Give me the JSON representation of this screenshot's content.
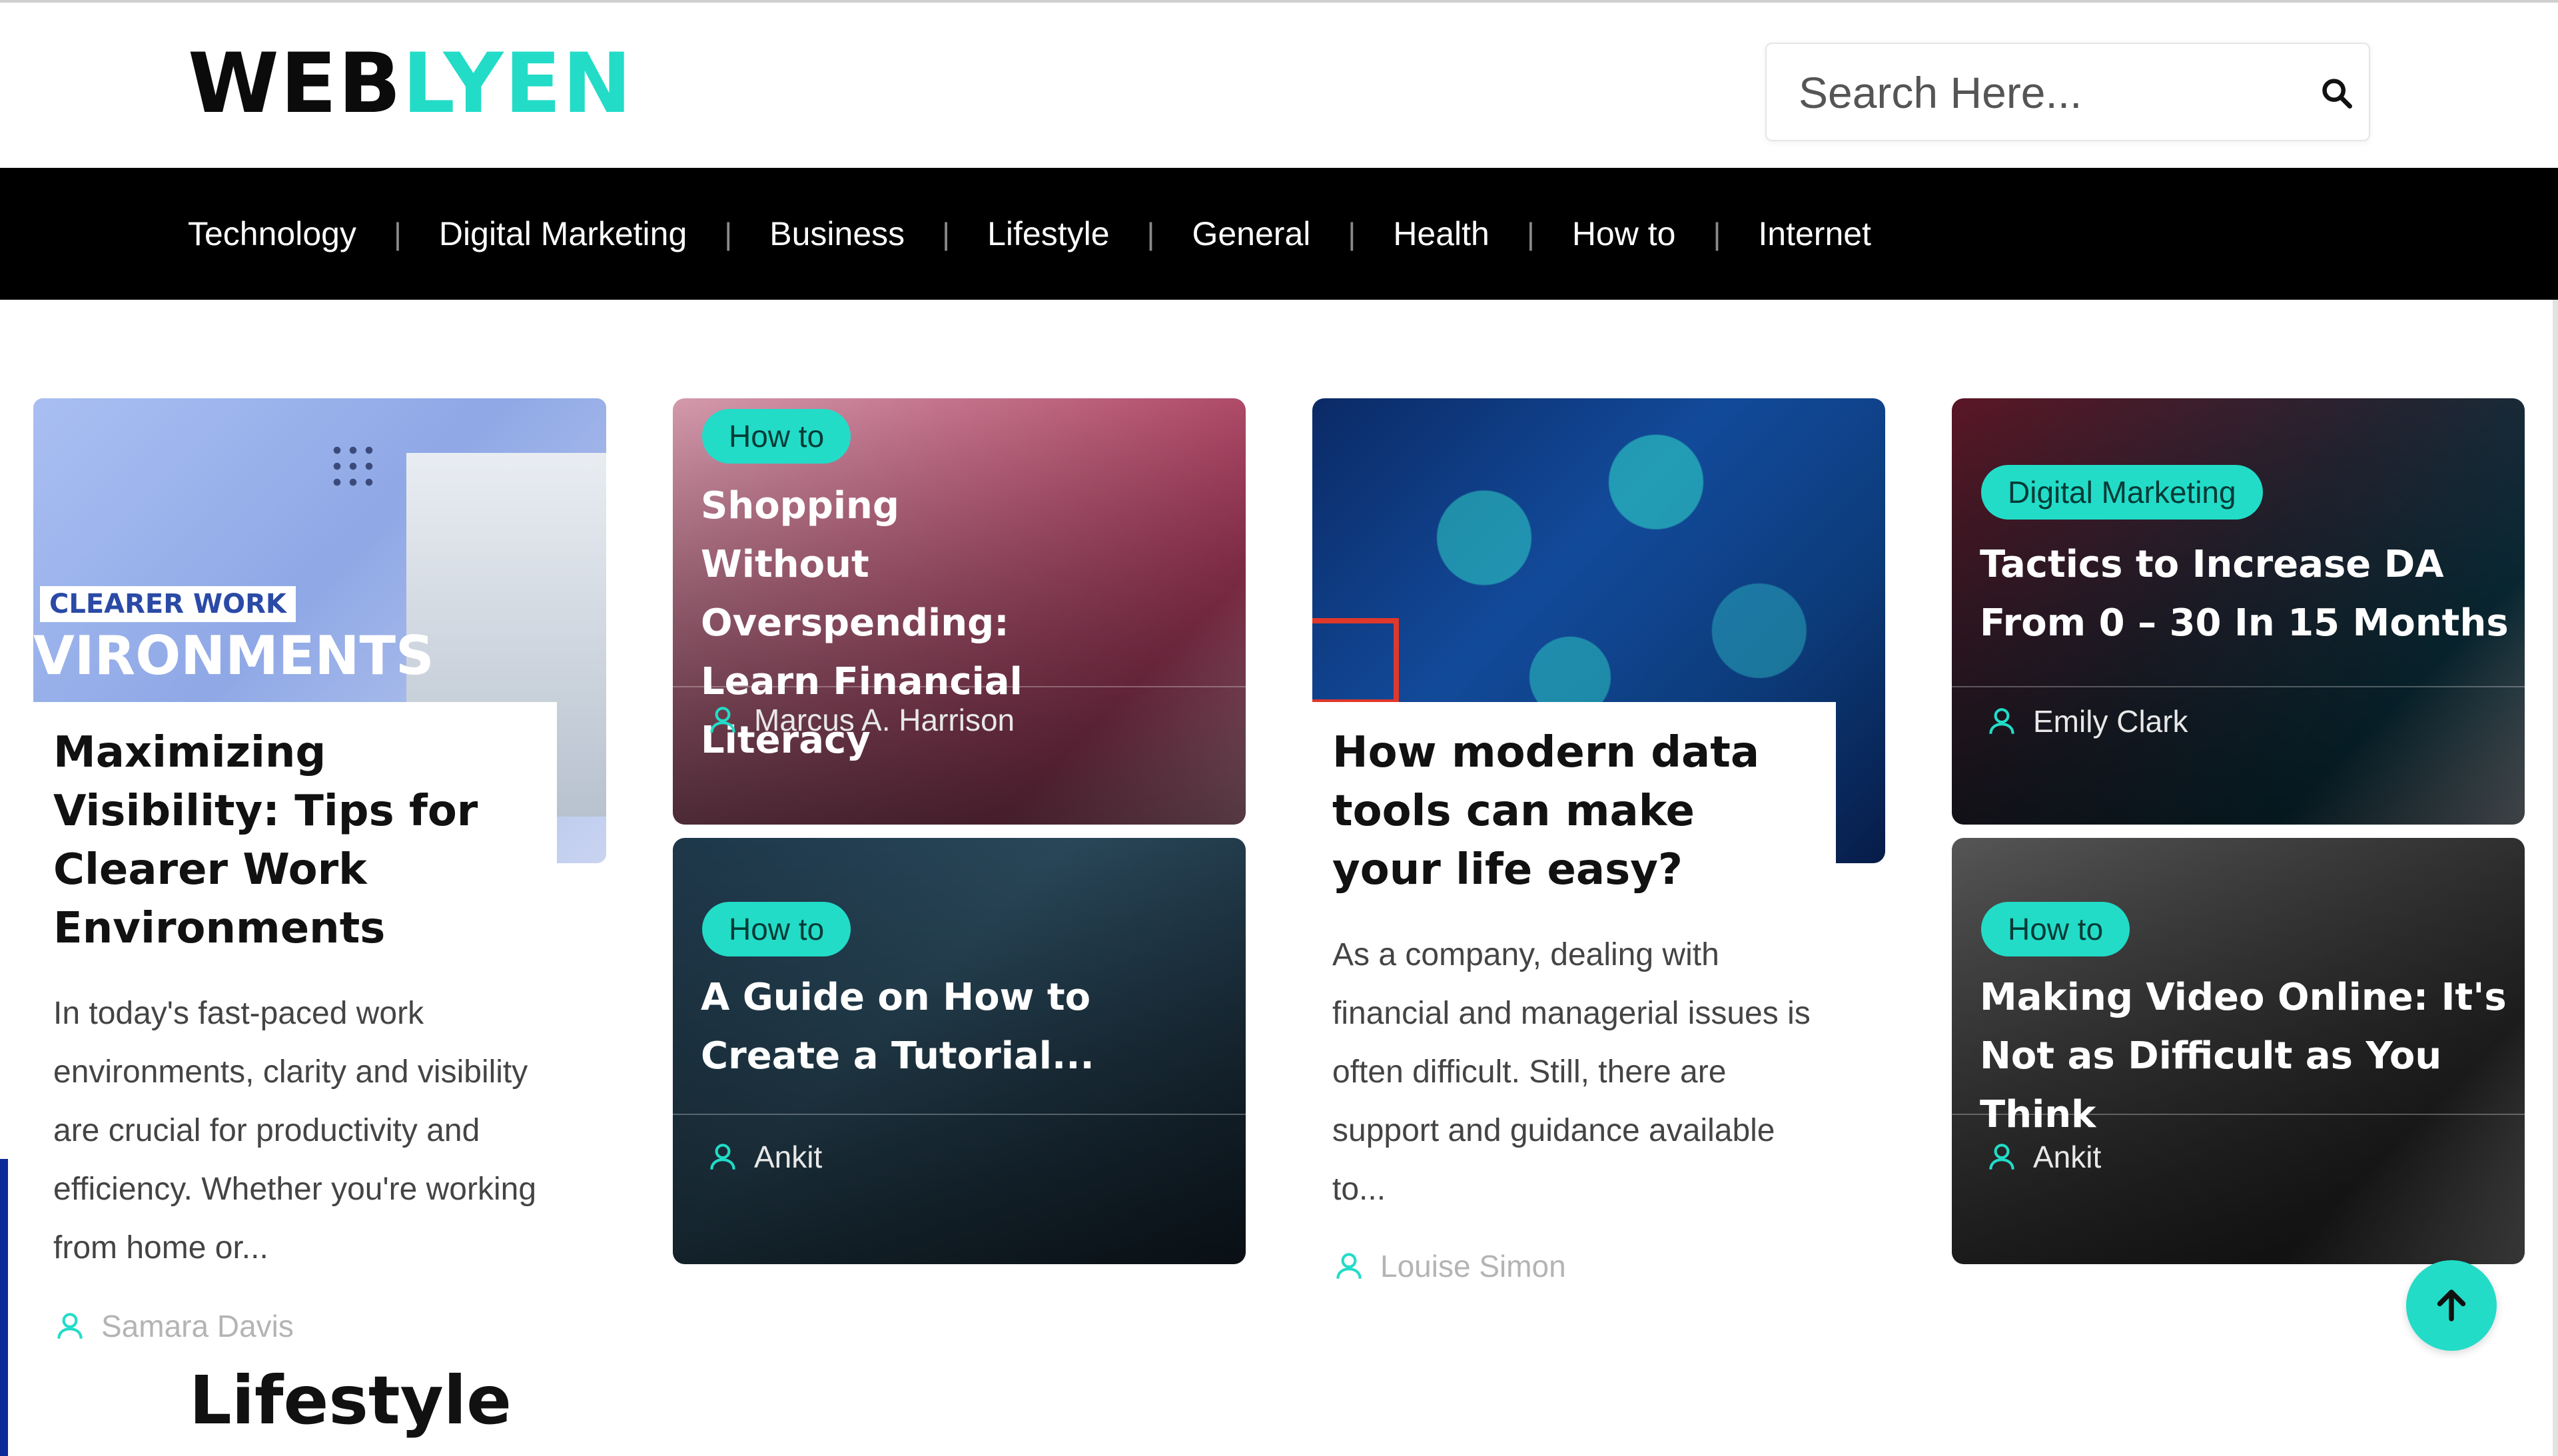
{
  "brand": {
    "logo_part1": "WEB",
    "logo_part2": "LYEN",
    "accent_color": "#22dcc8"
  },
  "search": {
    "placeholder": "Search Here...",
    "icon": "search-icon"
  },
  "nav": {
    "items": [
      "Technology",
      "Digital Marketing",
      "Business",
      "Lifestyle",
      "General",
      "Health",
      "How to",
      "Internet"
    ]
  },
  "posts": {
    "p1": {
      "image_text": "CLEARER WORK",
      "image_text2": "VIRONMENTS",
      "title": "Maximizing Visibility: Tips for Clearer Work Environments",
      "excerpt": "In today's fast-paced work environments, clarity and visibility are crucial for productivity and efficiency. Whether you're working from home or...",
      "author": "Samara Davis"
    },
    "p2": {
      "category": "How to",
      "title": "Shopping Without Overspending: Learn Financial Literacy",
      "author": "Marcus A. Harrison"
    },
    "p3": {
      "category": "How to",
      "title": "A Guide on How to Create a Tutorial...",
      "author": "Ankit"
    },
    "p4": {
      "title": "How modern data tools can make your life easy?",
      "excerpt": "As a company, dealing with financial and managerial issues is often difficult. Still, there are support and guidance available to...",
      "author": "Louise Simon"
    },
    "p5": {
      "category": "Digital Marketing",
      "title": "Tactics to Increase DA From 0 – 30 In 15 Months",
      "author": "Emily Clark"
    },
    "p6": {
      "category": "How to",
      "title": "Making Video Online: It's Not as Difficult as You Think",
      "author": "Ankit"
    }
  },
  "section": {
    "title": "Lifestyle"
  },
  "icons": {
    "author": "user-icon",
    "scroll": "arrow-up-icon"
  }
}
